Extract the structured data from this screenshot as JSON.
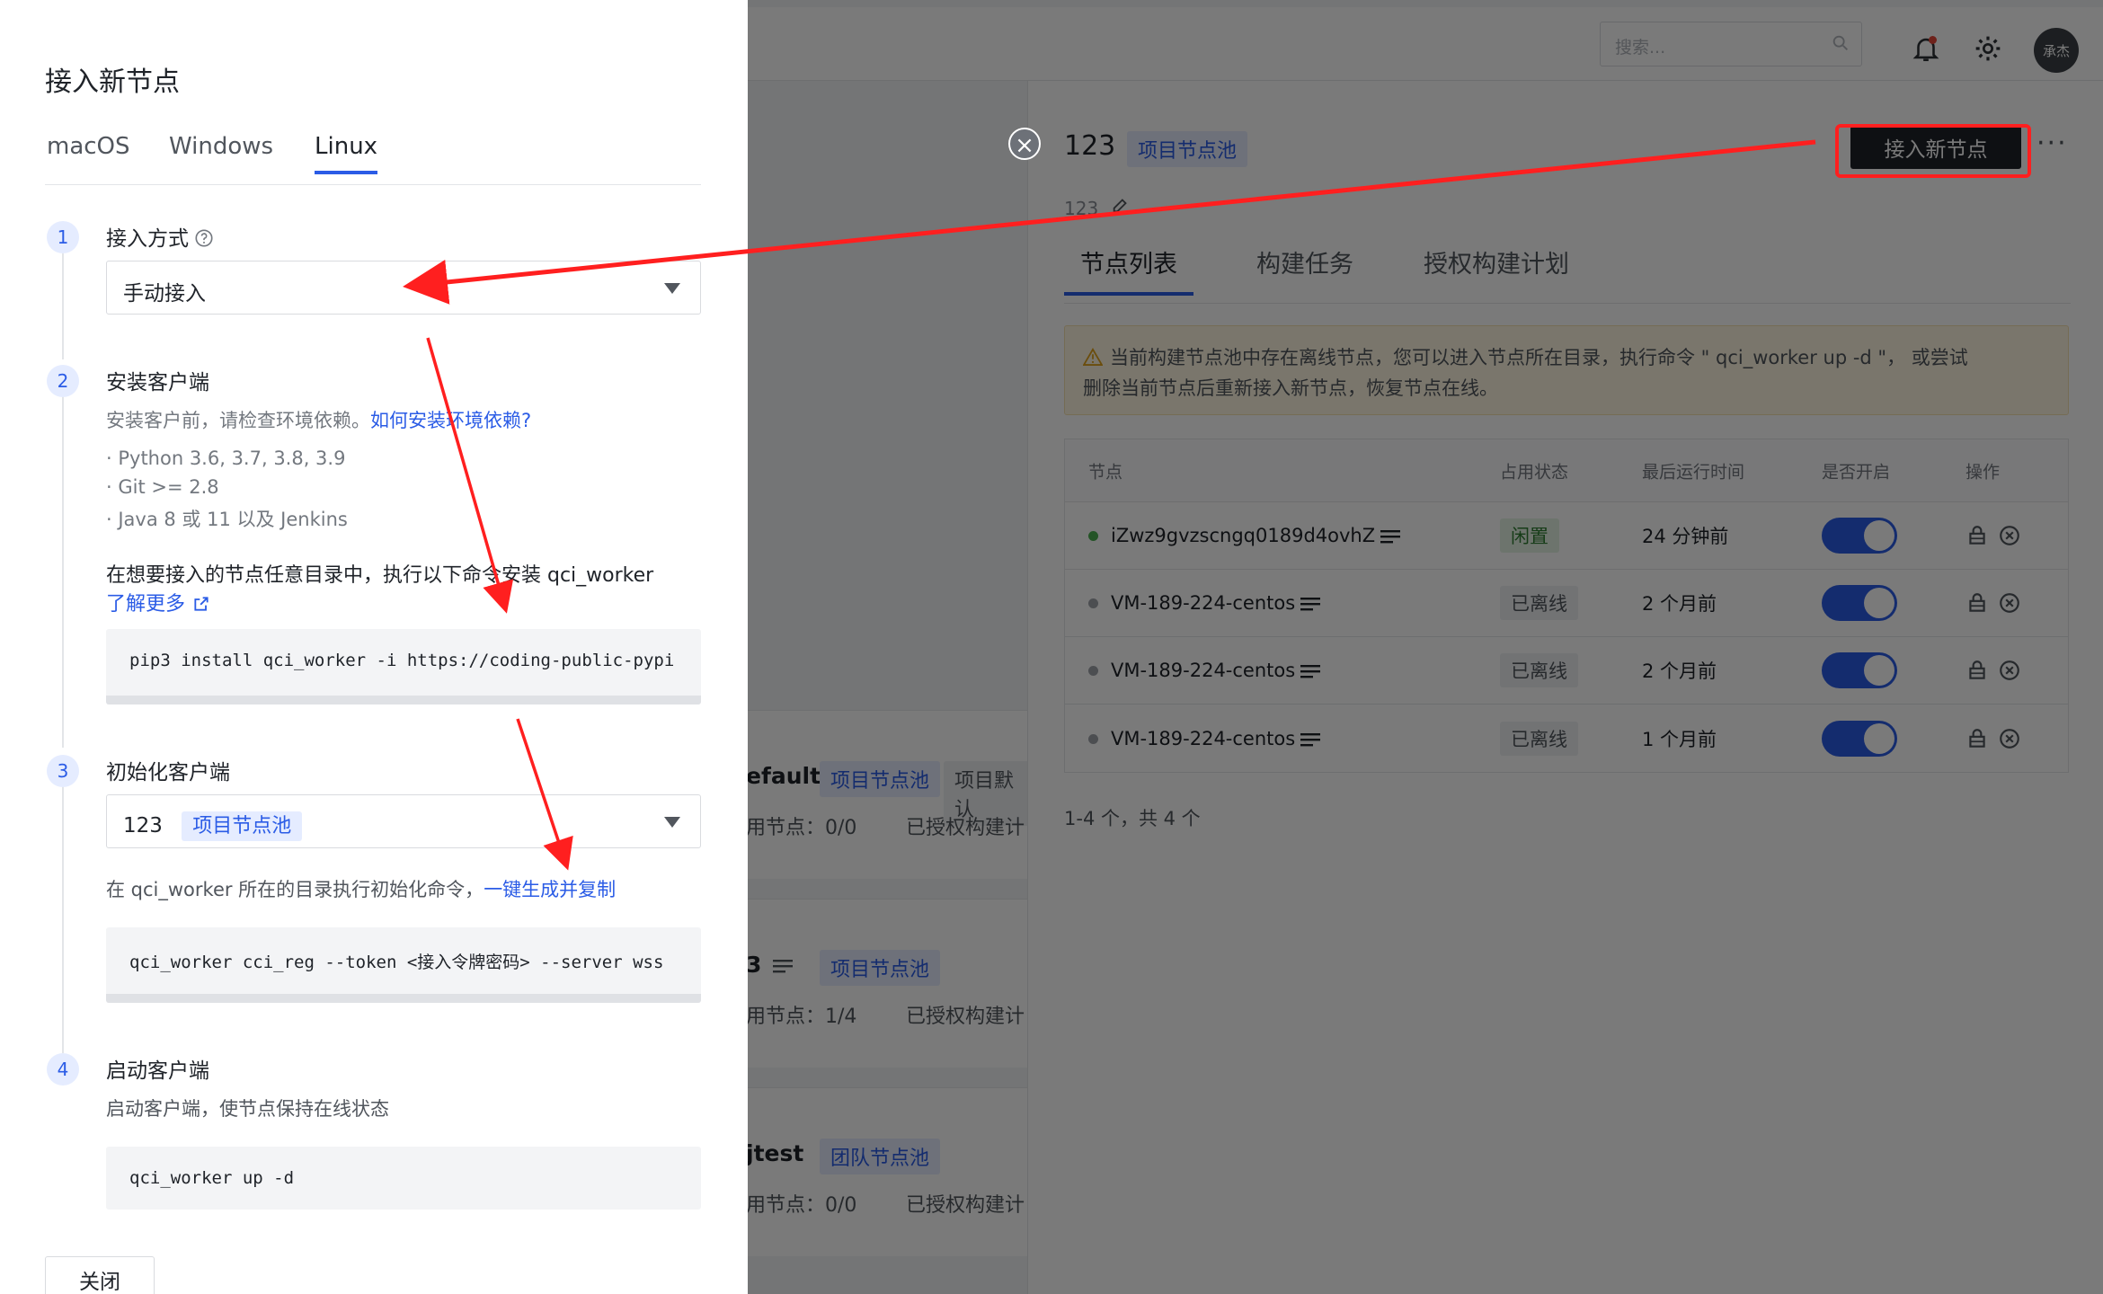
{
  "topbar": {
    "search_placeholder": "搜索...",
    "avatar_text": "承杰"
  },
  "background_cards": [
    {
      "title": "efault",
      "tag": "项目节点池",
      "tag2": "项目默认",
      "meta1": "用节点：0/0",
      "meta2": "已授权构建计"
    },
    {
      "title": "3",
      "tag": "项目节点池",
      "meta1": "用节点：1/4",
      "meta2": "已授权构建计"
    },
    {
      "title": "jtest",
      "tag": "团队节点池",
      "meta1": "用节点：0/0",
      "meta2": "已授权构建计"
    }
  ],
  "detail": {
    "close_glyph": "×",
    "title": "123",
    "title_tag": "项目节点池",
    "description": "123",
    "connect_button": "接入新节点",
    "more": "···",
    "tabs": [
      "节点列表",
      "构建任务",
      "授权构建计划"
    ],
    "warning_line1": "当前构建节点池中存在离线节点，您可以进入节点所在目录，执行命令 \" qci_worker up -d \"， 或尝试",
    "warning_line2": "删除当前节点后重新接入新节点，恢复节点在线。",
    "columns": [
      "节点",
      "占用状态",
      "最后运行时间",
      "是否开启",
      "操作"
    ],
    "rows": [
      {
        "name": "iZwz9gvzscngq0189d4ovhZ",
        "state": "闲置",
        "last_run": "24 分钟前",
        "online": true
      },
      {
        "name": "VM-189-224-centos",
        "state": "已离线",
        "last_run": "2 个月前",
        "online": false
      },
      {
        "name": "VM-189-224-centos",
        "state": "已离线",
        "last_run": "2 个月前",
        "online": false
      },
      {
        "name": "VM-189-224-centos",
        "state": "已离线",
        "last_run": "1 个月前",
        "online": false
      }
    ],
    "pager": "1-4 个，共 4 个"
  },
  "drawer": {
    "title": "接入新节点",
    "os_tabs": [
      "macOS",
      "Windows",
      "Linux"
    ],
    "step1": {
      "num": "1",
      "title": "接入方式",
      "select_value": "手动接入"
    },
    "step2": {
      "num": "2",
      "title": "安装客户端",
      "hint": "安装客户前，请检查环境依赖。",
      "hint_link": "如何安装环境依赖?",
      "req1": "· Python 3.6, 3.7, 3.8, 3.9",
      "req2": "· Git >= 2.8",
      "req3": "· Java 8 或 11 以及 Jenkins",
      "instruction": "在想要接入的节点任意目录中，执行以下命令安装 qci_worker",
      "learn_more": "了解更多",
      "code": "pip3 install qci_worker -i https://coding-public-pypi"
    },
    "step3": {
      "num": "3",
      "title": "初始化客户端",
      "select_value": "123",
      "select_tag": "项目节点池",
      "instruction": "在 qci_worker 所在的目录执行初始化命令，",
      "instruction_link": "一键生成并复制",
      "code": "qci_worker cci_reg --token <接入令牌密码> --server wss"
    },
    "step4": {
      "num": "4",
      "title": "启动客户端",
      "instruction": "启动客户端，使节点保持在线状态",
      "code": "qci_worker up -d"
    },
    "close_button": "关闭"
  },
  "colors": {
    "accent": "#2b5ce6",
    "online": "#4caf50",
    "offline": "#a0a4aa",
    "idle_tag_bg": "#e3f3e3",
    "idle_tag_fg": "#2e7d32",
    "offline_tag_bg": "#eef0f3",
    "annotation": "#ff1f1f"
  }
}
